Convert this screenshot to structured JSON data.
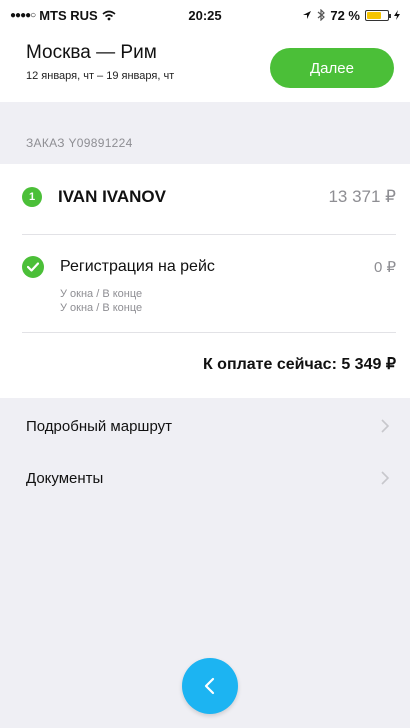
{
  "status_bar": {
    "carrier": "MTS RUS",
    "time": "20:25",
    "battery_percent": "72 %",
    "battery_level": 0.72
  },
  "header": {
    "route": "Москва — Рим",
    "dates": "12 января, чт – 19 января, чт",
    "next_label": "Далее"
  },
  "order": {
    "label": "ЗАКАЗ Y09891224",
    "passenger": {
      "number": "1",
      "name": "IVAN IVANOV",
      "price": "13 371 ₽"
    },
    "checkin": {
      "label": "Регистрация на рейс",
      "price": "0 ₽",
      "notes": [
        "У окна / В конце",
        "У окна / В конце"
      ]
    },
    "total": "К оплате сейчас:  5 349 ₽"
  },
  "links": [
    {
      "label": "Подробный маршрут"
    },
    {
      "label": "Документы"
    }
  ],
  "colors": {
    "accent_green": "#4bbf38",
    "back_button_blue": "#1cb4f2",
    "background": "#efeff4"
  },
  "icons": [
    "signal-dots-icon",
    "wifi-icon",
    "location-arrow-icon",
    "bluetooth-icon",
    "battery-icon",
    "charging-icon",
    "checkmark-icon",
    "chevron-right-icon",
    "chevron-left-icon"
  ]
}
